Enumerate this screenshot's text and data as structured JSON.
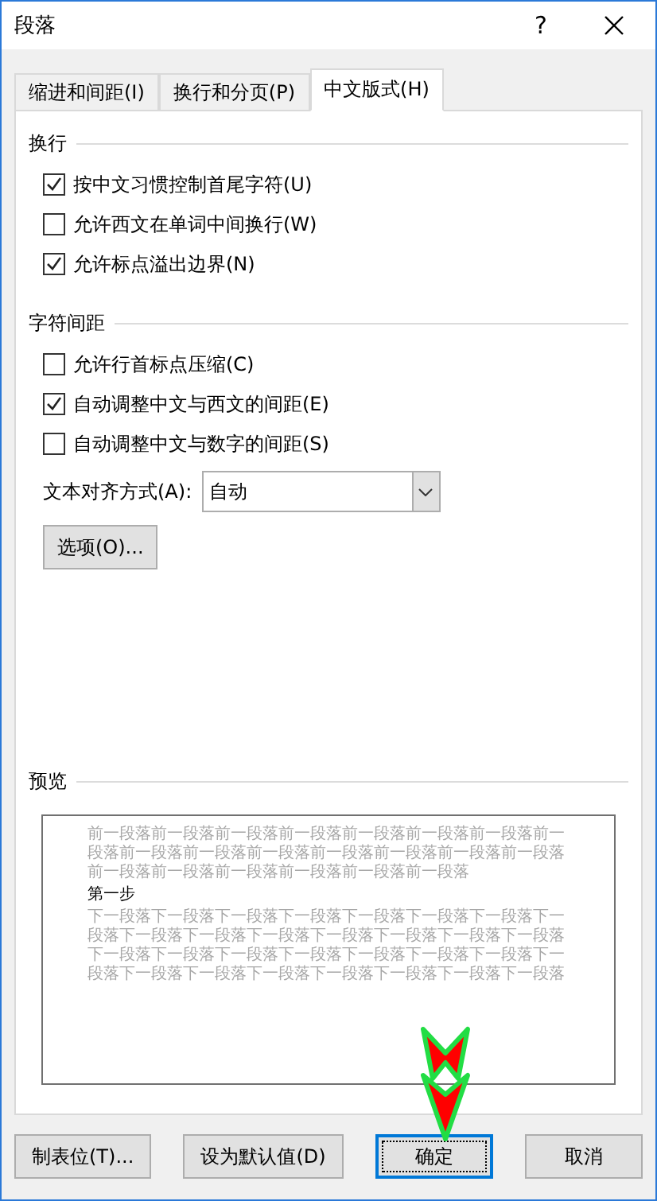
{
  "window": {
    "title": "段落",
    "help": "?"
  },
  "tabs": [
    {
      "label": "缩进和间距(I)",
      "selected": false
    },
    {
      "label": "换行和分页(P)",
      "selected": false
    },
    {
      "label": "中文版式(H)",
      "selected": true
    }
  ],
  "sections": [
    {
      "heading": "换行",
      "items": [
        {
          "kind": "checkbox",
          "label": "按中文习惯控制首尾字符(U)",
          "checked": true
        },
        {
          "kind": "checkbox",
          "label": "允许西文在单词中间换行(W)",
          "checked": false
        },
        {
          "kind": "checkbox",
          "label": "允许标点溢出边界(N)",
          "checked": true
        }
      ]
    },
    {
      "heading": "字符间距",
      "items": [
        {
          "kind": "checkbox",
          "label": "允许行首标点压缩(C)",
          "checked": false
        },
        {
          "kind": "checkbox",
          "label": "自动调整中文与西文的间距(E)",
          "checked": true
        },
        {
          "kind": "checkbox",
          "label": "自动调整中文与数字的间距(S)",
          "checked": false
        },
        {
          "kind": "select",
          "label": "文本对齐方式(A):",
          "value": "自动"
        },
        {
          "kind": "button",
          "label": "选项(O)..."
        }
      ]
    }
  ],
  "preview": {
    "heading": "预览",
    "before": "前一段落前一段落前一段落前一段落前一段落前一段落前一段落前一段落前一段落前一段落前一段落前一段落前一段落前一段落前一段落前一段落前一段落前一段落前一段落前一段落前一段落",
    "step": "第一步",
    "after": "下一段落下一段落下一段落下一段落下一段落下一段落下一段落下一段落下一段落下一段落下一段落下一段落下一段落下一段落下一段落下一段落下一段落下一段落下一段落下一段落下一段落下一段落下一段落下一段落下一段落下一段落下一段落下一段落下一段落下一段落"
  },
  "buttons": [
    {
      "label": "制表位(T)...",
      "default": false
    },
    {
      "label": "设为默认值(D)",
      "default": false
    },
    {
      "label": "确定",
      "default": true
    },
    {
      "label": "取消",
      "default": false
    }
  ],
  "annotation": {
    "kind": "arrow"
  }
}
